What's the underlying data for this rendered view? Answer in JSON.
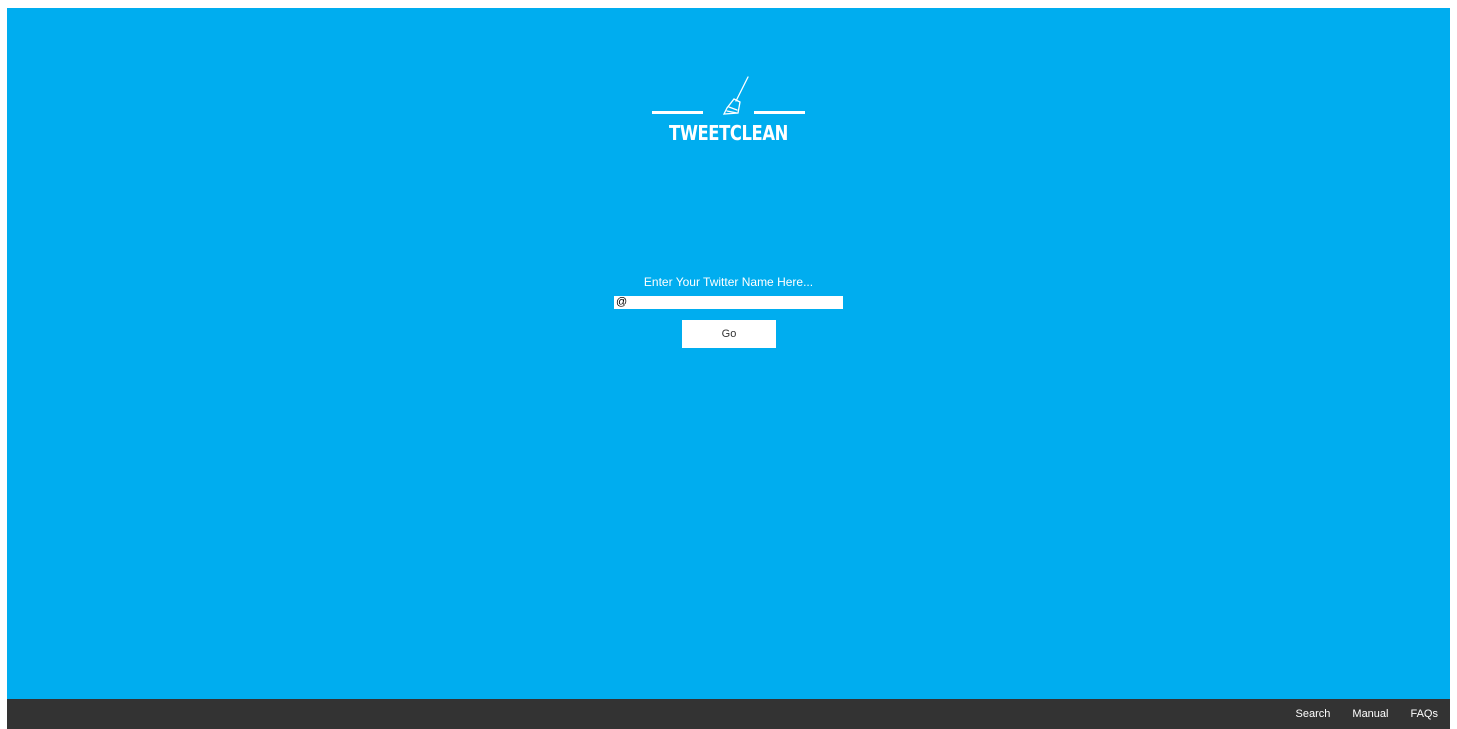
{
  "brand": {
    "logo_text": "TWEETCLEAN",
    "icon": "broom-icon"
  },
  "form": {
    "prompt": "Enter Your Twitter Name Here...",
    "input_value": "@",
    "button_label": "Go"
  },
  "footer": {
    "links": [
      {
        "label": "Search"
      },
      {
        "label": "Manual"
      },
      {
        "label": "FAQs"
      }
    ]
  },
  "colors": {
    "background": "#00adef",
    "footer": "#333333",
    "text": "#ffffff"
  }
}
